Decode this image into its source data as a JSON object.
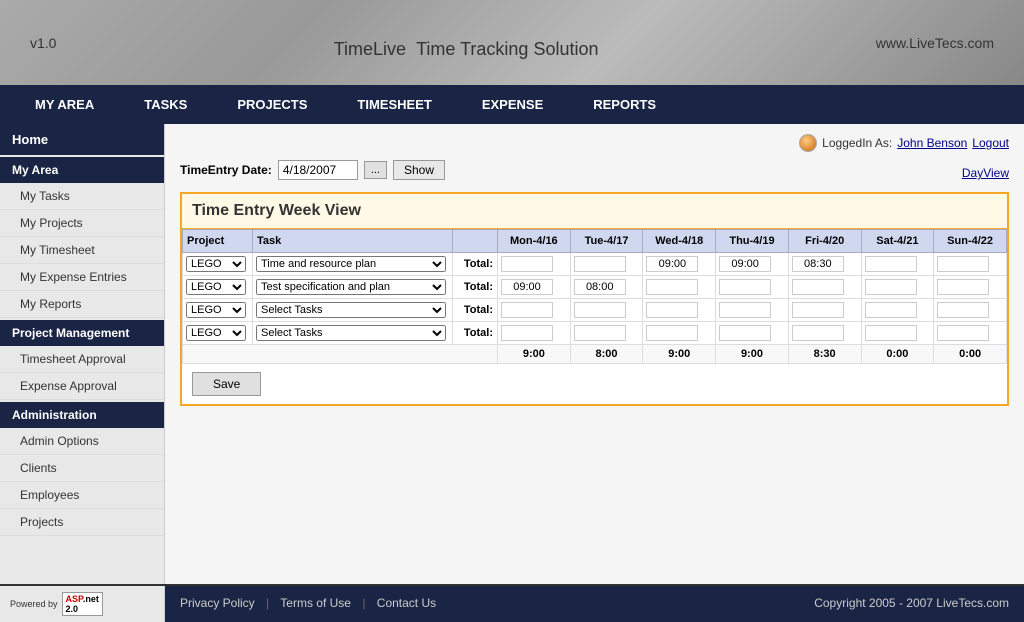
{
  "header": {
    "version": "v1.0",
    "title": "TimeLive",
    "subtitle": "Time Tracking Solution",
    "website": "www.LiveTecs.com"
  },
  "nav": {
    "items": [
      {
        "label": "MY AREA"
      },
      {
        "label": "TASKS"
      },
      {
        "label": "PROJECTS"
      },
      {
        "label": "TIMESHEET"
      },
      {
        "label": "EXPENSE"
      },
      {
        "label": "REPORTS"
      }
    ]
  },
  "sidebar": {
    "home": "Home",
    "my_area": "My Area",
    "items_my_area": [
      {
        "label": "My Tasks"
      },
      {
        "label": "My Projects"
      },
      {
        "label": "My Timesheet"
      },
      {
        "label": "My Expense Entries"
      },
      {
        "label": "My Reports"
      }
    ],
    "project_management": "Project Management",
    "items_pm": [
      {
        "label": "Timesheet Approval"
      },
      {
        "label": "Expense Approval"
      }
    ],
    "administration": "Administration",
    "items_admin": [
      {
        "label": "Admin Options"
      },
      {
        "label": "Clients"
      },
      {
        "label": "Employees"
      },
      {
        "label": "Projects"
      }
    ]
  },
  "content": {
    "logged_in_label": "LoggedIn As:",
    "user_name": "John Benson",
    "logout": "Logout",
    "day_view": "DayView",
    "date_label": "TimeEntry Date:",
    "date_value": "4/18/2007",
    "date_btn": "...",
    "show_btn": "Show",
    "title": "Time Entry Week View",
    "table": {
      "headers": [
        "Project",
        "Task",
        "",
        "Mon-4/16",
        "Tue-4/17",
        "Wed-4/18",
        "Thu-4/19",
        "Fri-4/20",
        "Sat-4/21",
        "Sun-4/22"
      ],
      "rows": [
        {
          "project": "LEGO",
          "task": "Time and resource plan",
          "total": "Total:",
          "mon": "",
          "tue": "",
          "wed": "09:00",
          "thu": "09:00",
          "fri": "08:30",
          "sat": "",
          "sun": ""
        },
        {
          "project": "LEGO",
          "task": "Test specification and plan",
          "total": "Total:",
          "mon": "09:00",
          "tue": "08:00",
          "wed": "",
          "thu": "",
          "fri": "",
          "sat": "",
          "sun": ""
        },
        {
          "project": "LEGO",
          "task": "Select Tasks",
          "total": "Total:",
          "mon": "",
          "tue": "",
          "wed": "",
          "thu": "",
          "fri": "",
          "sat": "",
          "sun": ""
        },
        {
          "project": "LEGO",
          "task": "Select Tasks",
          "total": "Total:",
          "mon": "",
          "tue": "",
          "wed": "",
          "thu": "",
          "fri": "",
          "sat": "",
          "sun": ""
        }
      ],
      "totals": {
        "label": "",
        "mon": "9:00",
        "tue": "8:00",
        "wed": "9:00",
        "thu": "9:00",
        "fri": "8:30",
        "sat": "0:00",
        "sun": "0:00"
      }
    },
    "save_btn": "Save"
  },
  "footer": {
    "privacy": "Privacy Policy",
    "terms": "Terms of Use",
    "contact": "Contact Us",
    "copyright": "Copyright 2005 - 2007 LiveTecs.com",
    "powered_by": "Powered by",
    "aspnet": "ASP.net 2.0"
  }
}
